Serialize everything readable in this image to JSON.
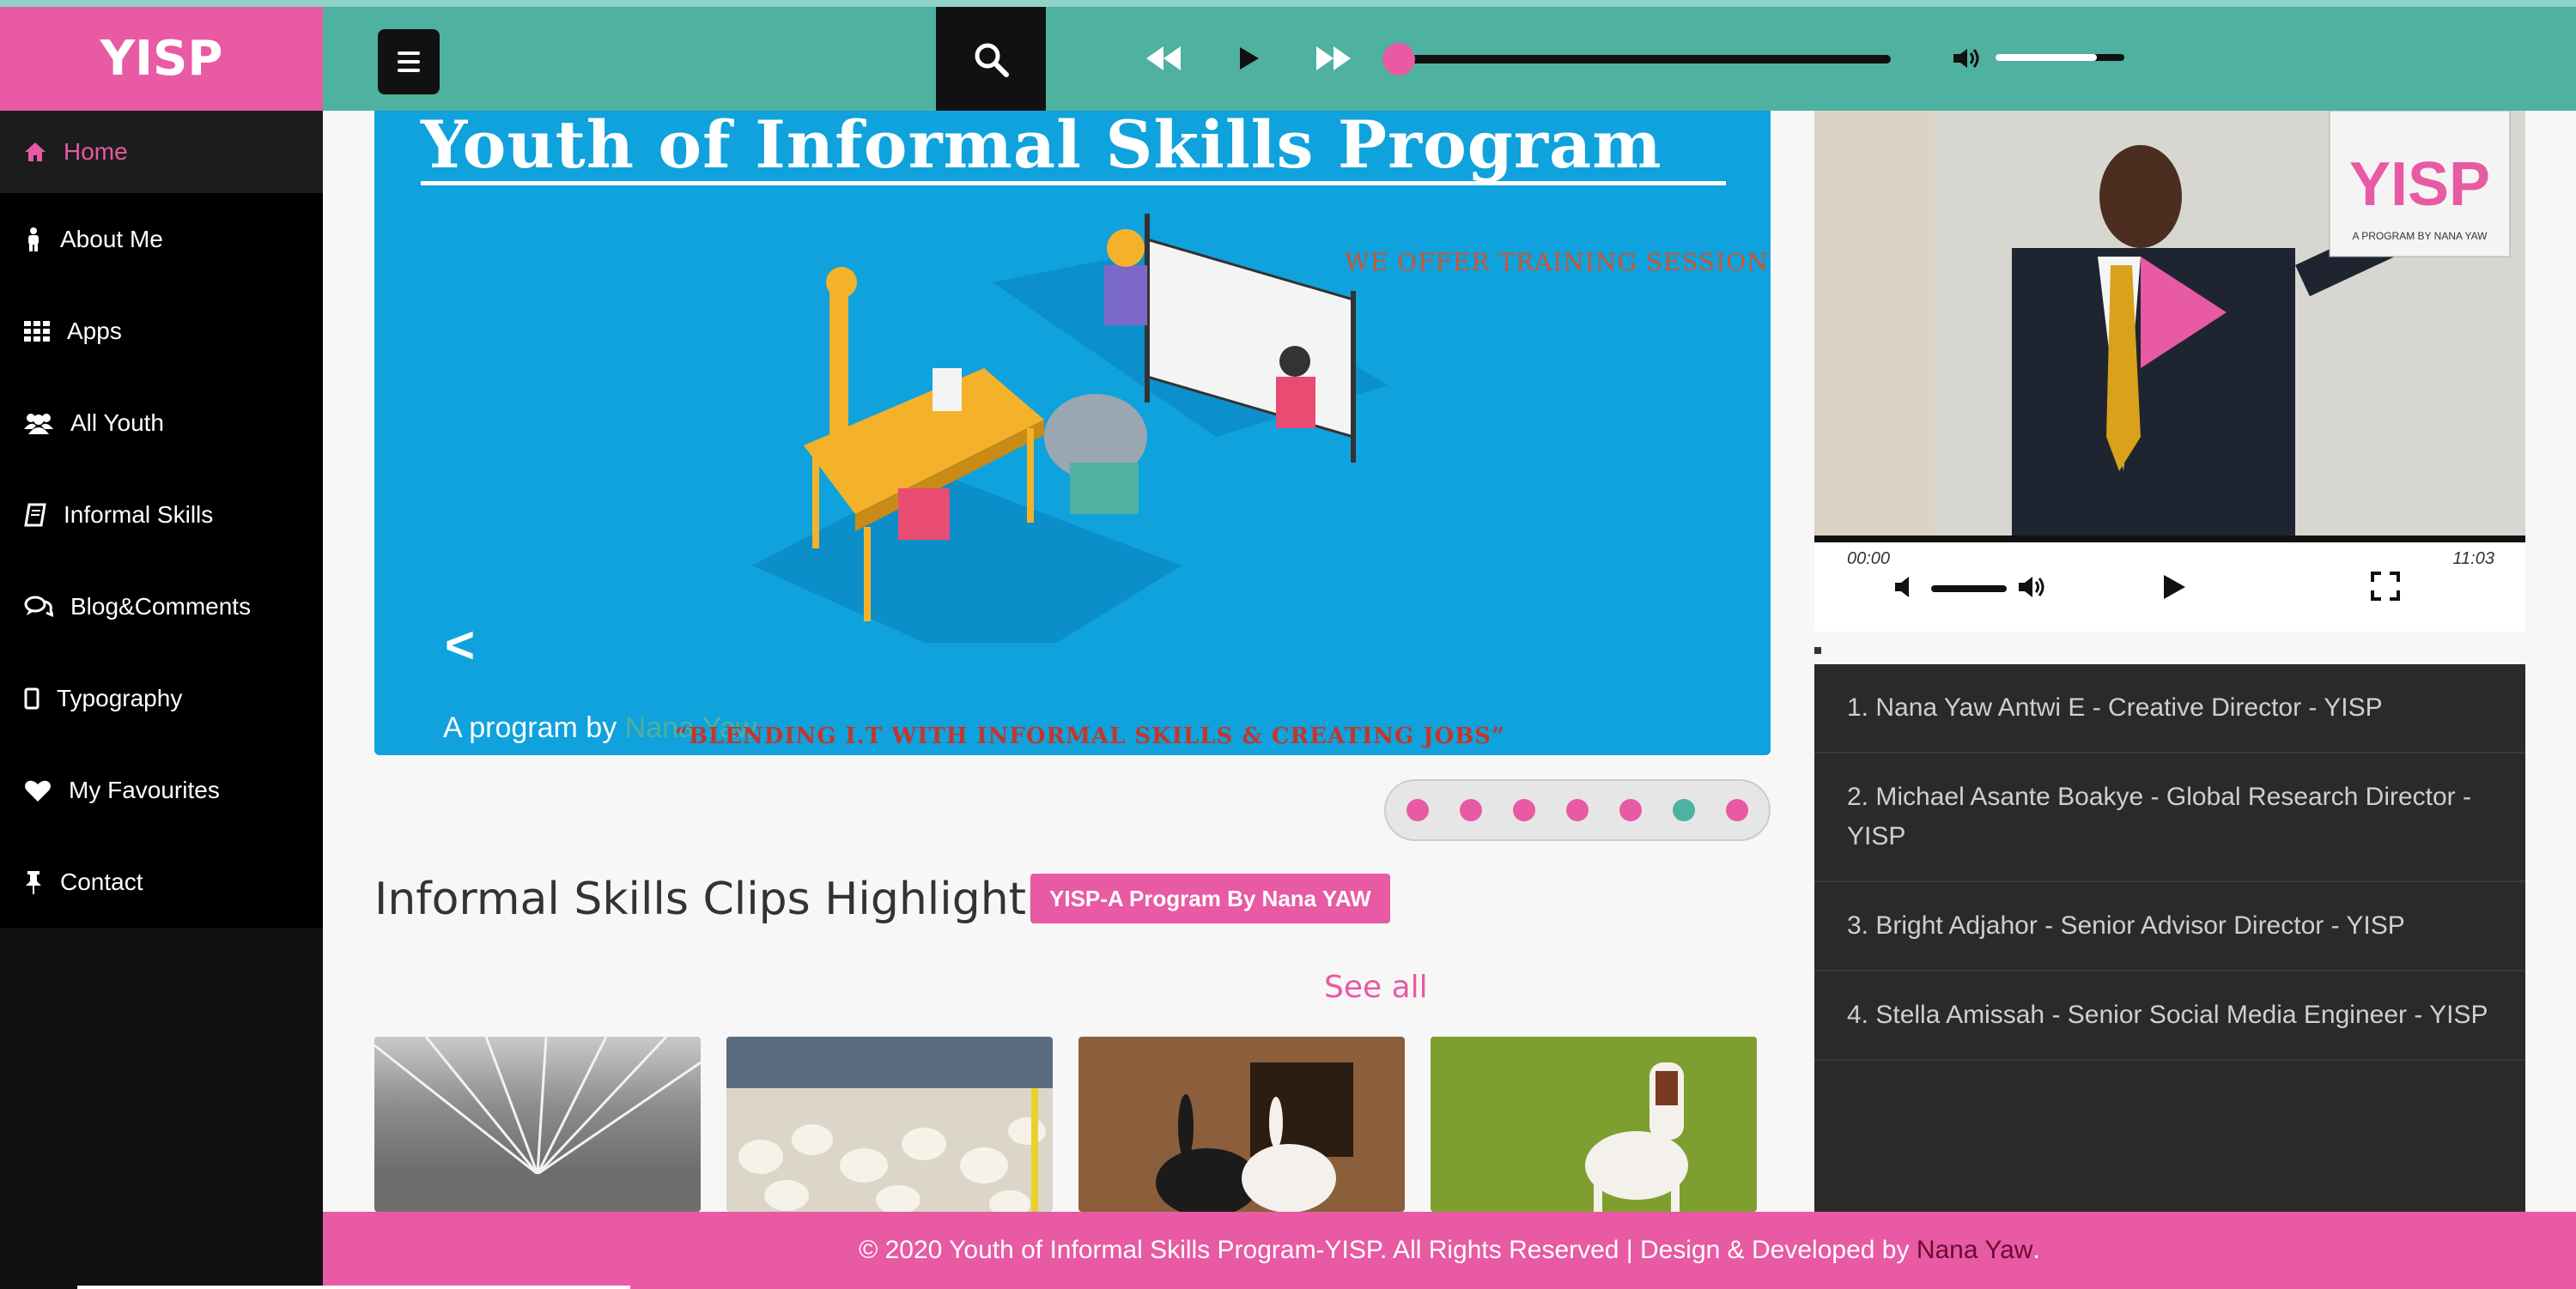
{
  "app": {
    "logo": "YISP"
  },
  "sidebar": {
    "items": [
      {
        "label": "Home",
        "icon": "home-icon"
      },
      {
        "label": "About Me",
        "icon": "person-icon"
      },
      {
        "label": "Apps",
        "icon": "grid-icon"
      },
      {
        "label": "All Youth",
        "icon": "users-icon"
      },
      {
        "label": "Informal Skills",
        "icon": "book-icon"
      },
      {
        "label": "Blog&Comments",
        "icon": "comments-icon"
      },
      {
        "label": "Typography",
        "icon": "mobile-icon"
      },
      {
        "label": "My Favourites",
        "icon": "heart-icon"
      },
      {
        "label": "Contact",
        "icon": "pin-icon"
      }
    ]
  },
  "player": {
    "progress": 0,
    "volume": 0.8
  },
  "banner": {
    "title": "Youth of Informal Skills Program",
    "offer": "WE OFFER TRAINING SESSION",
    "program_by": "A program by",
    "program_author": "Nana Yaw",
    "slogan": "“BLENDING I.T WITH INFORMAL SKILLS & CREATING JOBS”",
    "prev": "<"
  },
  "carousel": {
    "active_dot": 5,
    "dot_count": 7
  },
  "section": {
    "title": "Informal Skills Clips Highlighting",
    "badge": "YISP-A Program By Nana YAW",
    "see_all": "See all"
  },
  "video": {
    "current_time": "00:00",
    "duration": "11:03",
    "logo_text": "YISP",
    "logo_caption": "A PROGRAM BY NANA YAW"
  },
  "team": [
    "1. Nana Yaw Antwi E - Creative Director - YISP",
    "2. Michael Asante Boakye - Global Research Director - YISP",
    "3. Bright Adjahor - Senior Advisor Director - YISP",
    "4. Stella Amissah - Senior Social Media Engineer - YISP"
  ],
  "footer": {
    "text": "© 2020 Youth of Informal Skills Program-YISP. All Rights Reserved | Design & Developed by",
    "author": "Nana Yaw",
    "end": "."
  },
  "colors": {
    "accent": "#e85aa3",
    "teal": "#4fb19f",
    "dark": "#111111"
  }
}
